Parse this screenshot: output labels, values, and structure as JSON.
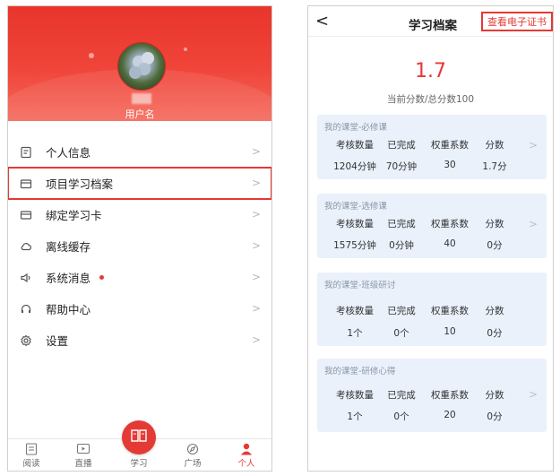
{
  "left": {
    "username": "用户名",
    "menu": [
      {
        "label": "个人信息",
        "icon": "document-icon"
      },
      {
        "label": "项目学习档案",
        "icon": "folder-icon"
      },
      {
        "label": "绑定学习卡",
        "icon": "card-icon"
      },
      {
        "label": "离线缓存",
        "icon": "cloud-icon"
      },
      {
        "label": "系统消息",
        "icon": "speaker-icon"
      },
      {
        "label": "帮助中心",
        "icon": "headset-icon"
      },
      {
        "label": "设置",
        "icon": "gear-icon"
      }
    ],
    "chevron": ">",
    "tabs": [
      {
        "label": "阅读"
      },
      {
        "label": "直播"
      },
      {
        "label": "学习"
      },
      {
        "label": "广场"
      },
      {
        "label": "个人"
      }
    ],
    "accent": "#e53935"
  },
  "right": {
    "back": "<",
    "title": "学习档案",
    "cert_button": "查看电子证书",
    "score": "1.7",
    "score_sub": "当前分数/总分数100",
    "headers": [
      "考核数量",
      "已完成",
      "权重系数",
      "分数"
    ],
    "cards": [
      {
        "title": "我的课堂-必修课",
        "values": [
          "1204分钟",
          "70分钟",
          "30",
          "1.7分"
        ],
        "chevron": ">"
      },
      {
        "title": "我的课堂-选修课",
        "values": [
          "1575分钟",
          "0分钟",
          "40",
          "0分"
        ],
        "chevron": ">"
      },
      {
        "title": "我的课堂-班级研讨",
        "values": [
          "1个",
          "0个",
          "10",
          "0分"
        ],
        "chevron": ""
      },
      {
        "title": "我的课堂-研修心得",
        "values": [
          "1个",
          "0个",
          "20",
          "0分"
        ],
        "chevron": ">"
      }
    ]
  }
}
